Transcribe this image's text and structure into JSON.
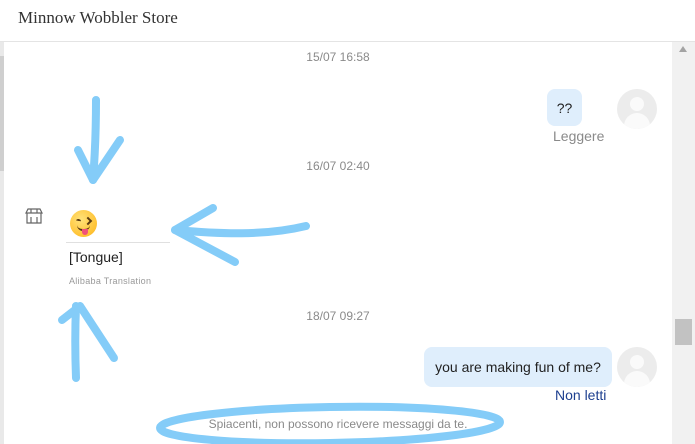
{
  "header": {
    "title": "Minnow Wobbler Store"
  },
  "conversation": {
    "timestamps": [
      "15/07 16:58",
      "16/07 02:40",
      "18/07 09:27"
    ],
    "outgoing_1": {
      "text": "??",
      "status": "Leggere"
    },
    "incoming_1": {
      "emoji_icon": "tongue-out-emoji",
      "translated_text": "[Tongue]",
      "translation_credit": "Alibaba Translation"
    },
    "outgoing_2": {
      "text": "you are making fun of me?",
      "status": "Non letti"
    },
    "system_note": "Spiacenti, non possono ricevere messaggi da te."
  },
  "colors": {
    "bubble_out": "#dfeefc",
    "status_unread": "#1d3f8f",
    "annotation": "#84ccf8"
  }
}
